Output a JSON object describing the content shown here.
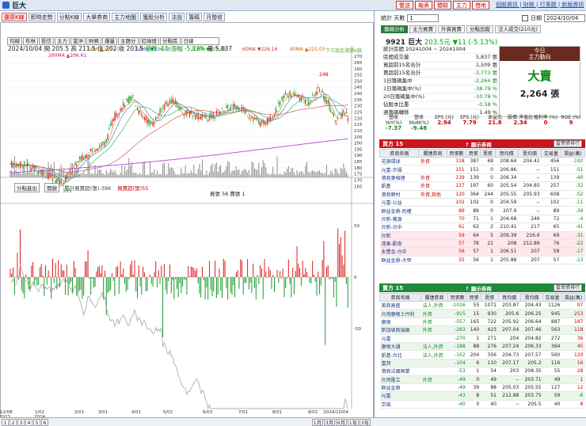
{
  "app": {
    "title": "巨大"
  },
  "toolbar": [
    "還原K線",
    "即時走勢",
    "分點K線",
    "大單券商",
    "主力地圖",
    "獲股分析",
    "法說",
    "籌碼",
    "月營收"
  ],
  "top_right": [
    "警送",
    "報表",
    "體驗",
    "主力",
    "借地"
  ],
  "top_links": "個股資訊 | 財務 | 行事曆 | 新版資訊",
  "chart_toolbar": {
    "buttons": [
      "均線",
      "布林",
      "投信",
      "主力",
      "當沖",
      "財務",
      "爆量",
      "主題分",
      "紅綠燈",
      "分點區"
    ],
    "period": "日線"
  },
  "ma_legend": [
    "260MA ▲206.61",
    "5MA ▲210.10",
    "10MA ▼224.00",
    "20MA ▼225.43",
    "60MA ▼226.16",
    "40MA ▲225.03",
    "下方設定選擇K線"
  ],
  "info": {
    "date": "2024/10/04",
    "open": "開 205.5",
    "high": "高 211.5",
    "low": "低 202",
    "close": "收 203.5",
    "change": "漲跌 -11",
    "pct": "漲幅 -5.13%",
    "vol": "量 5,837"
  },
  "y_labels": [
    "270",
    "265",
    "260",
    "255",
    "250",
    "245",
    "240",
    "235",
    "230",
    "225",
    "220",
    "215",
    "210",
    "205",
    "200",
    "195",
    "190",
    "185",
    "180",
    "175",
    "170",
    "165"
  ],
  "price_marks": {
    "high": "248",
    "low": "165"
  },
  "sub_info": {
    "select": "分點進出",
    "btn": "開啟",
    "legend1": "累計買賣超(張)-396",
    "legend2": "買賣超(張)55",
    "legend3": "買張 56 賣張 1"
  },
  "sub_y": [
    "50",
    "0",
    "-50"
  ],
  "x_labels": [
    "112/08\n2023",
    "1/02\n2024",
    "2/01",
    "3/01",
    "4/01",
    "5/02",
    "6/03",
    "7/01",
    "8/01",
    "9/02",
    "2024/10/04"
  ],
  "bottom_bar": {
    "pages": [
      "1",
      "2",
      "3",
      "4",
      "5",
      "6"
    ],
    "ranges": [
      "1月",
      "3月",
      "6月",
      "1年",
      "3年"
    ]
  },
  "right": {
    "pager_label": "統計 天數",
    "pager_value": "1",
    "date_label": "日期",
    "date_value": "2024/10/04",
    "tabs": [
      "籌碼分析",
      "主力買賣",
      "外資買賣",
      "分點追蹤",
      "法人成交(210元)"
    ],
    "stock": {
      "code": "9921 巨大",
      "price": "203.5元",
      "change": "▼11 (-5.13%)"
    },
    "summary": [
      {
        "k": "統計區間 20241004 ~ 20241004",
        "v": ""
      },
      {
        "k": "區間成交量",
        "v": "5,837 張"
      },
      {
        "k": "買超前15名合計",
        "v": "1,509 張"
      },
      {
        "k": "賣超前15名合計",
        "v": "-3,773 張"
      },
      {
        "k": "1日籌碼集中",
        "v": "-2,264 張"
      },
      {
        "k": "1日籌碼集中(%)",
        "v": "-38.79 %"
      },
      {
        "k": "20日籌碼集中(%)",
        "v": "-10.78 %"
      },
      {
        "k": "佔股本比重",
        "v": "-0.58 %"
      },
      {
        "k": "週籌碼轉移",
        "v": "1.49 %"
      }
    ],
    "big": {
      "h1": "今日",
      "h2": "主力動向",
      "dir": "大賣",
      "num": "2,264 張"
    },
    "ratios": [
      {
        "k": "營收 YoY(%)",
        "v": "-7.37"
      },
      {
        "k": "營收 MoM(%)",
        "v": "-9.48"
      },
      {
        "k": "EPS (元)",
        "v": "2.94"
      },
      {
        "k": "EPS (元)",
        "v": "7.79"
      },
      {
        "k": "本益比",
        "v": "21.8"
      },
      {
        "k": "股價 淨值比",
        "v": "2.34"
      },
      {
        "k": "殖利率 (%)",
        "v": "0"
      },
      {
        "k": "ROE (%)",
        "v": "9"
      }
    ],
    "buy_header": {
      "title": "買方 15",
      "mid": "↑ 顯示券商",
      "sel": "當買張排行"
    },
    "cols": [
      "券商名稱",
      "關連券商",
      "買張數",
      "買張",
      "賣張",
      "買均價",
      "賣均價",
      "交易量",
      "損益(萬)"
    ],
    "buy_rows": [
      [
        "花旗環球",
        "外資",
        "318",
        "387",
        "69",
        "208.64",
        "204.41",
        "456",
        "-192"
      ],
      [
        "元富-宗福",
        "",
        "151",
        "151",
        "0",
        "206.86",
        "--",
        "151",
        "-51"
      ],
      [
        "港商麥格理",
        "外資",
        "139",
        "139",
        "0",
        "206.34",
        "--",
        "139",
        "-40"
      ],
      [
        "凱基",
        "外資",
        "137",
        "197",
        "60",
        "205.54",
        "204.85",
        "257",
        "-32"
      ],
      [
        "港商野村",
        "外資,其他",
        "120",
        "364",
        "244",
        "205.55",
        "205.93",
        "608",
        "-52"
      ],
      [
        "元富-公益",
        "",
        "102",
        "102",
        "0",
        "204.59",
        "--",
        "102",
        "-11"
      ],
      [
        "群益金鼎-民權",
        "",
        "89",
        "89",
        "0",
        "207.9",
        "--",
        "89",
        "-39"
      ],
      [
        "台新-萬源",
        "",
        "70",
        "71",
        "1",
        "204.68",
        "246",
        "72",
        "-4"
      ],
      [
        "台新-台中",
        "",
        "61",
        "63",
        "2",
        "210.41",
        "217",
        "65",
        "-41"
      ],
      [
        "台新",
        "",
        "59",
        "64",
        "5",
        "209.39",
        "216.6",
        "69",
        "-31"
      ],
      [
        "遠東-歡南",
        "",
        "57",
        "78",
        "21",
        "208",
        "212.89",
        "76",
        "-22"
      ],
      [
        "永豐金-台中",
        "",
        "56",
        "57",
        "1",
        "206.51",
        "207",
        "58",
        "-17"
      ],
      [
        "群益金鼎-大甲",
        "",
        "55",
        "56",
        "1",
        "205.88",
        "207",
        "57",
        "-13"
      ]
    ],
    "sell_header": {
      "title": "賣方 15",
      "mid": "↑ 顯示券商",
      "sel": "當賣張排行"
    },
    "sell_rows": [
      [
        "美商高盛",
        "法人,外資",
        "-1016",
        "55",
        "1071",
        "203.87",
        "204.43",
        "1126",
        "97"
      ],
      [
        "台灣摩根士丹利",
        "外資",
        "-915",
        "15",
        "930",
        "205.6",
        "206.25",
        "945",
        "253"
      ],
      [
        "摩根",
        "外資",
        "-557",
        "165",
        "722",
        "205.92",
        "206.64",
        "887",
        "187"
      ],
      [
        "新加坡商瑞銀",
        "外資",
        "-283",
        "140",
        "423",
        "207.04",
        "207.46",
        "563",
        "118"
      ],
      [
        "元富",
        "",
        "-270",
        "1",
        "271",
        "204",
        "204.82",
        "272",
        "36"
      ],
      [
        "摩根大通",
        "法人,外資",
        "-188",
        "88",
        "276",
        "207.24",
        "206.33",
        "364",
        "45"
      ],
      [
        "凱基-台北",
        "法人,外資",
        "-152",
        "204",
        "356",
        "204.73",
        "207.57",
        "560",
        "120"
      ],
      [
        "富邦",
        "",
        "-104",
        "6",
        "110",
        "207.17",
        "205.2",
        "116",
        "16"
      ],
      [
        "港商法國興業",
        "",
        "-53",
        "1",
        "54",
        "203",
        "208.35",
        "55",
        "28"
      ],
      [
        "台灣匯立",
        "外資",
        "-49",
        "0",
        "49",
        "--",
        "203.71",
        "49",
        "1"
      ],
      [
        "群益金鼎",
        "",
        "-49",
        "39",
        "88",
        "205.03",
        "205.55",
        "127",
        "12"
      ],
      [
        "元富",
        "",
        "-43",
        "8",
        "51",
        "212.88",
        "203.75",
        "59",
        "-6"
      ],
      [
        "京城",
        "",
        "-40",
        "0",
        "40",
        "--",
        "205.5",
        "40",
        "8"
      ]
    ]
  }
}
